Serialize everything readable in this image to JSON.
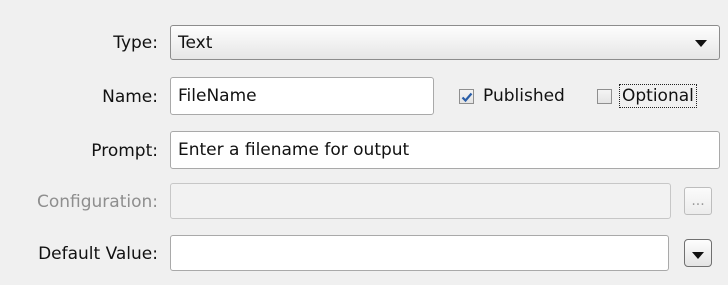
{
  "form": {
    "type": {
      "label": "Type:",
      "value": "Text"
    },
    "name": {
      "label": "Name:",
      "value": "FileName",
      "published_label": "Published",
      "published_checked": true,
      "optional_label": "Optional",
      "optional_checked": false
    },
    "prompt": {
      "label": "Prompt:",
      "value": "Enter a filename for output"
    },
    "configuration": {
      "label": "Configuration:",
      "value": "",
      "browse_label": "...",
      "enabled": false
    },
    "default_value": {
      "label": "Default Value:",
      "value": ""
    }
  },
  "icons": {
    "type_dropdown": "chevron-down-icon",
    "published_checkbox": "checkmark-icon",
    "default_dropdown": "chevron-down-icon"
  },
  "colors": {
    "panel_bg": "#f0f0f0",
    "disabled_text": "#8e8e8e",
    "checkmark": "#2a5ea8"
  }
}
